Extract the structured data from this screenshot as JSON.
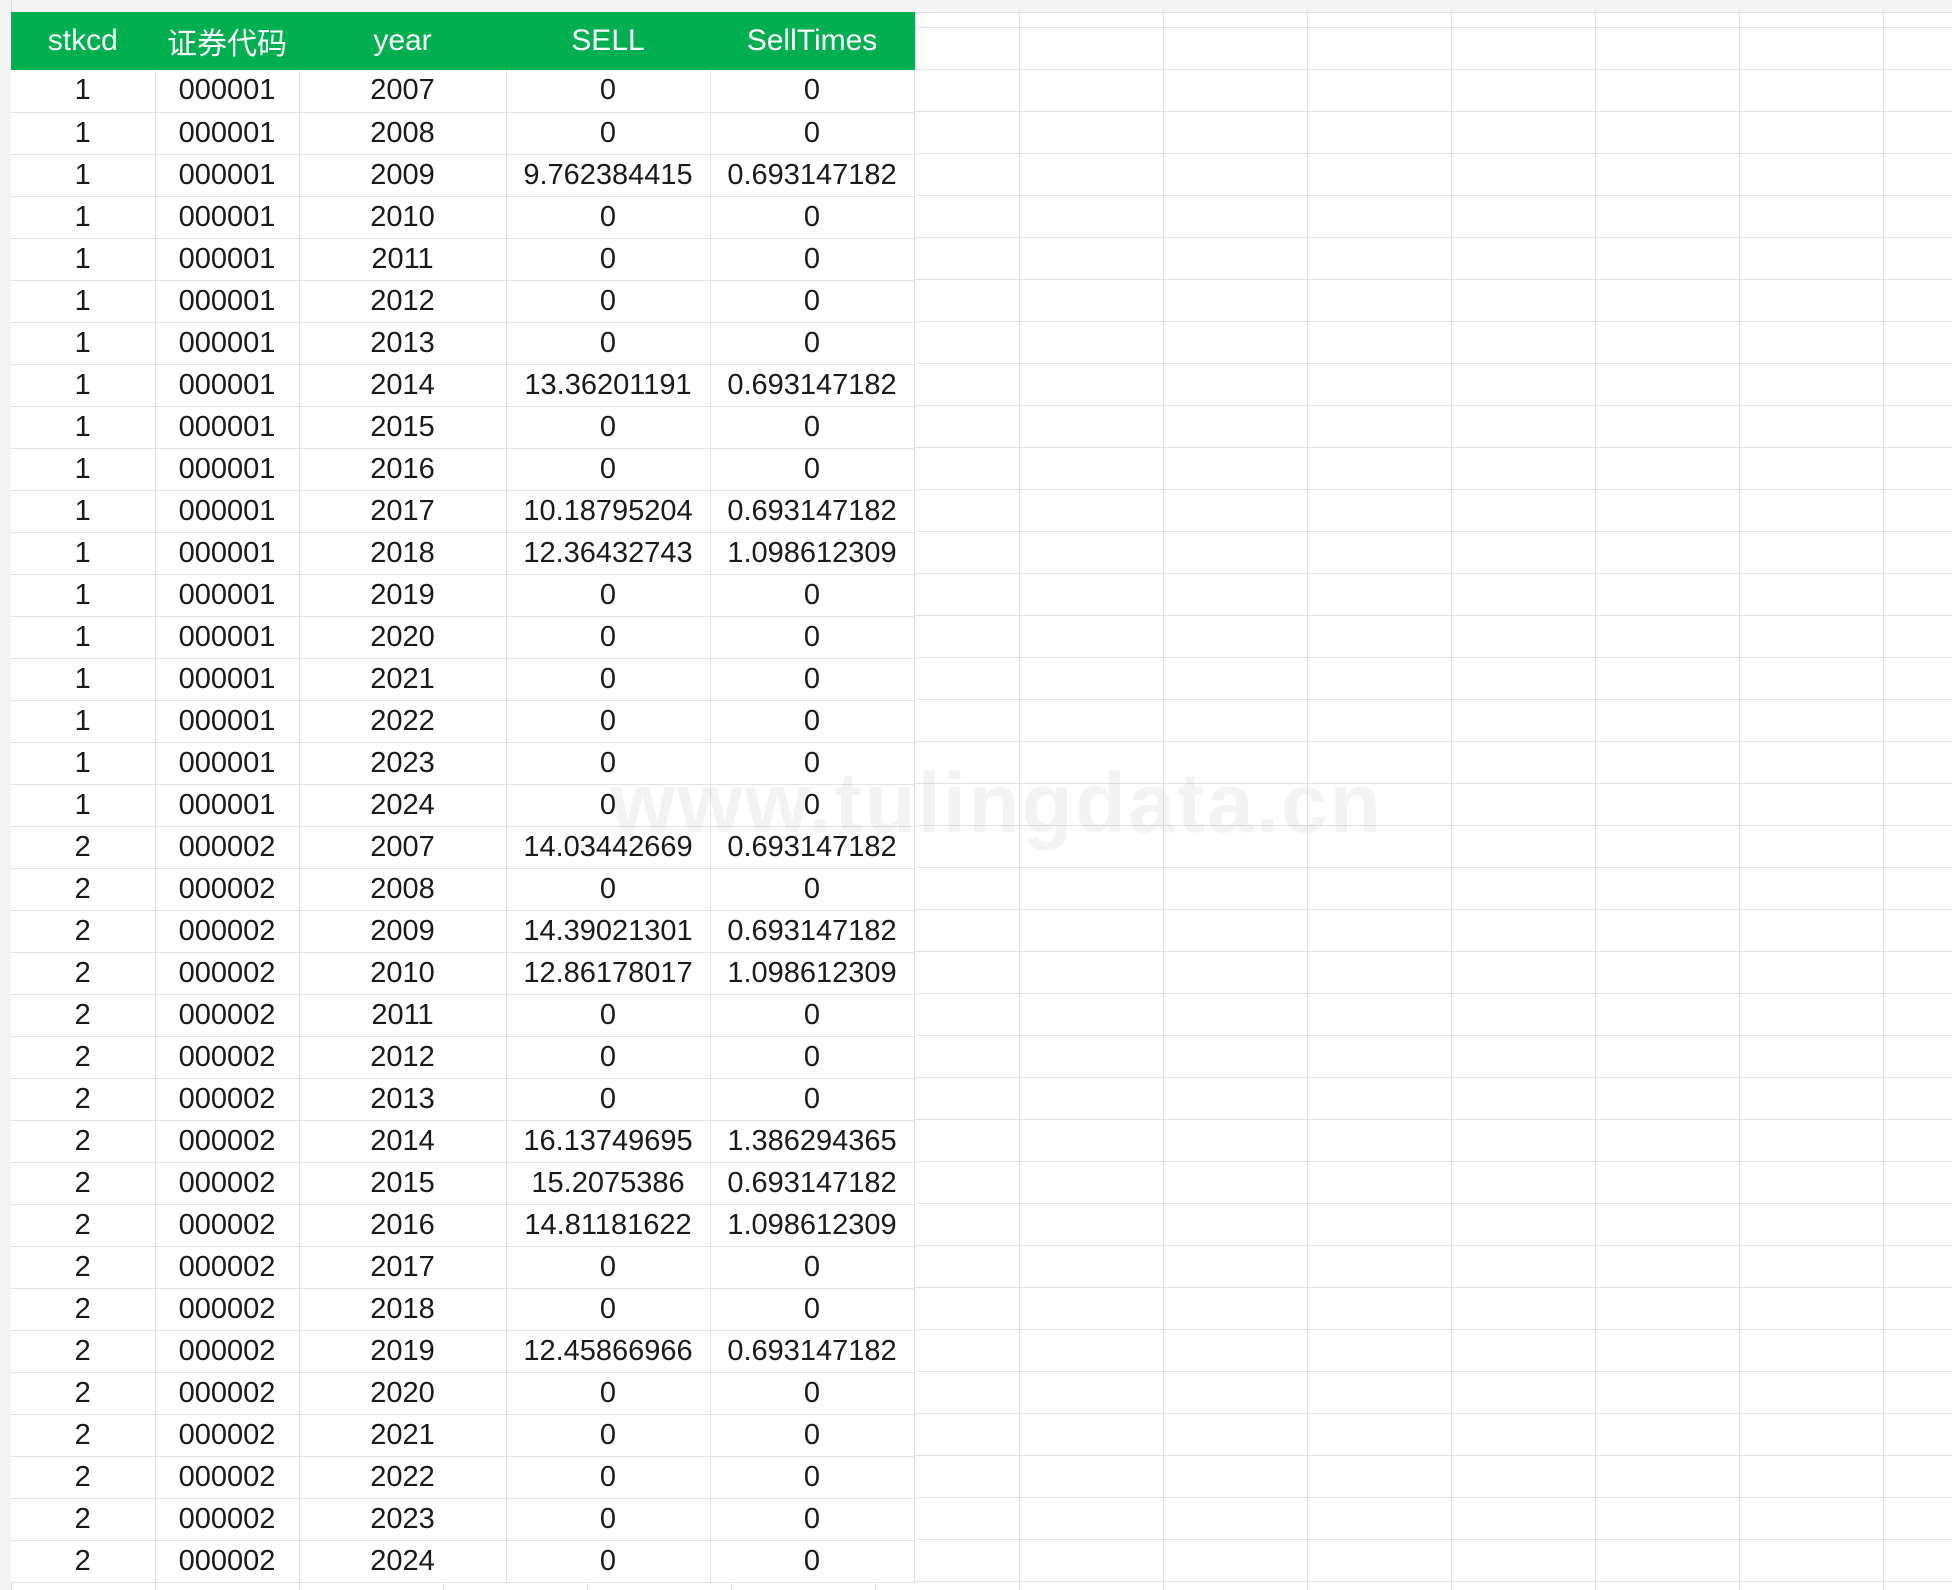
{
  "watermark": "www.tulingdata.cn",
  "colors": {
    "header_bg": "#00b050",
    "header_text": "#ffffff",
    "grid": "#e3e3e3"
  },
  "table": {
    "columns": [
      "stkcd",
      "证券代码",
      "year",
      "SELL",
      "SellTimes"
    ],
    "rows": [
      [
        "1",
        "000001",
        "2007",
        "0",
        "0"
      ],
      [
        "1",
        "000001",
        "2008",
        "0",
        "0"
      ],
      [
        "1",
        "000001",
        "2009",
        "9.762384415",
        "0.693147182"
      ],
      [
        "1",
        "000001",
        "2010",
        "0",
        "0"
      ],
      [
        "1",
        "000001",
        "2011",
        "0",
        "0"
      ],
      [
        "1",
        "000001",
        "2012",
        "0",
        "0"
      ],
      [
        "1",
        "000001",
        "2013",
        "0",
        "0"
      ],
      [
        "1",
        "000001",
        "2014",
        "13.36201191",
        "0.693147182"
      ],
      [
        "1",
        "000001",
        "2015",
        "0",
        "0"
      ],
      [
        "1",
        "000001",
        "2016",
        "0",
        "0"
      ],
      [
        "1",
        "000001",
        "2017",
        "10.18795204",
        "0.693147182"
      ],
      [
        "1",
        "000001",
        "2018",
        "12.36432743",
        "1.098612309"
      ],
      [
        "1",
        "000001",
        "2019",
        "0",
        "0"
      ],
      [
        "1",
        "000001",
        "2020",
        "0",
        "0"
      ],
      [
        "1",
        "000001",
        "2021",
        "0",
        "0"
      ],
      [
        "1",
        "000001",
        "2022",
        "0",
        "0"
      ],
      [
        "1",
        "000001",
        "2023",
        "0",
        "0"
      ],
      [
        "1",
        "000001",
        "2024",
        "0",
        "0"
      ],
      [
        "2",
        "000002",
        "2007",
        "14.03442669",
        "0.693147182"
      ],
      [
        "2",
        "000002",
        "2008",
        "0",
        "0"
      ],
      [
        "2",
        "000002",
        "2009",
        "14.39021301",
        "0.693147182"
      ],
      [
        "2",
        "000002",
        "2010",
        "12.86178017",
        "1.098612309"
      ],
      [
        "2",
        "000002",
        "2011",
        "0",
        "0"
      ],
      [
        "2",
        "000002",
        "2012",
        "0",
        "0"
      ],
      [
        "2",
        "000002",
        "2013",
        "0",
        "0"
      ],
      [
        "2",
        "000002",
        "2014",
        "16.13749695",
        "1.386294365"
      ],
      [
        "2",
        "000002",
        "2015",
        "15.2075386",
        "0.693147182"
      ],
      [
        "2",
        "000002",
        "2016",
        "14.81181622",
        "1.098612309"
      ],
      [
        "2",
        "000002",
        "2017",
        "0",
        "0"
      ],
      [
        "2",
        "000002",
        "2018",
        "0",
        "0"
      ],
      [
        "2",
        "000002",
        "2019",
        "12.45866966",
        "0.693147182"
      ],
      [
        "2",
        "000002",
        "2020",
        "0",
        "0"
      ],
      [
        "2",
        "000002",
        "2021",
        "0",
        "0"
      ],
      [
        "2",
        "000002",
        "2022",
        "0",
        "0"
      ],
      [
        "2",
        "000002",
        "2023",
        "0",
        "0"
      ],
      [
        "2",
        "000002",
        "2024",
        "0",
        "0"
      ]
    ]
  }
}
